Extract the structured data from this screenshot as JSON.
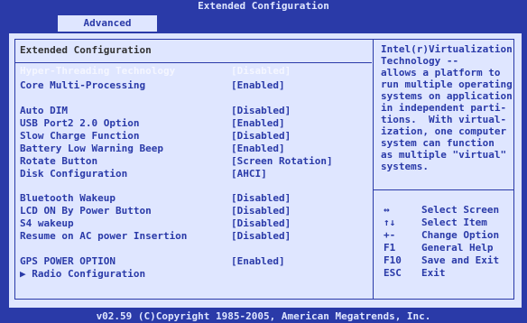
{
  "header": {
    "title": "Extended Configuration",
    "tab": "Advanced"
  },
  "main": {
    "section_title": "Extended Configuration",
    "items": [
      {
        "label": "Hyper-Threading Technology",
        "value": "[Disabled]"
      },
      {
        "label": "Core Multi-Processing",
        "value": "[Enabled]"
      },
      {
        "label": "Auto DIM",
        "value": "[Disabled]"
      },
      {
        "label": "USB Port2 2.0 Option",
        "value": "[Enabled]"
      },
      {
        "label": "Slow Charge Function",
        "value": "[Disabled]"
      },
      {
        "label": "Battery Low Warning Beep",
        "value": "[Enabled]"
      },
      {
        "label": "Rotate Button",
        "value": "[Screen Rotation]"
      },
      {
        "label": "Disk Configuration",
        "value": "[AHCI]"
      },
      {
        "label": "Bluetooth Wakeup",
        "value": "[Disabled]"
      },
      {
        "label": "LCD ON By Power Button",
        "value": "[Disabled]"
      },
      {
        "label": "S4 wakeup",
        "value": "[Disabled]"
      },
      {
        "label": "Resume on AC power Insertion",
        "value": "[Disabled]"
      },
      {
        "label": "GPS POWER OPTION",
        "value": "[Enabled]"
      }
    ],
    "submenu": "▶ Radio Configuration"
  },
  "help": {
    "text": "Intel(r)Virtualization\nTechnology --\nallows a platform to\nrun multiple operating\nsystems on application\nin independent parti-\ntions.  With virtual-\nization, one computer\nsystem can function\nas multiple \"virtual\"\nsystems."
  },
  "keys": [
    {
      "key": "↔",
      "action": "Select Screen"
    },
    {
      "key": "↑↓",
      "action": "Select Item"
    },
    {
      "key": "+-",
      "action": "Change Option"
    },
    {
      "key": "F1",
      "action": "General Help"
    },
    {
      "key": "F10",
      "action": "Save and Exit"
    },
    {
      "key": "ESC",
      "action": "Exit"
    }
  ],
  "footer": {
    "text": "v02.59 (C)Copyright 1985-2005, American Megatrends, Inc."
  }
}
